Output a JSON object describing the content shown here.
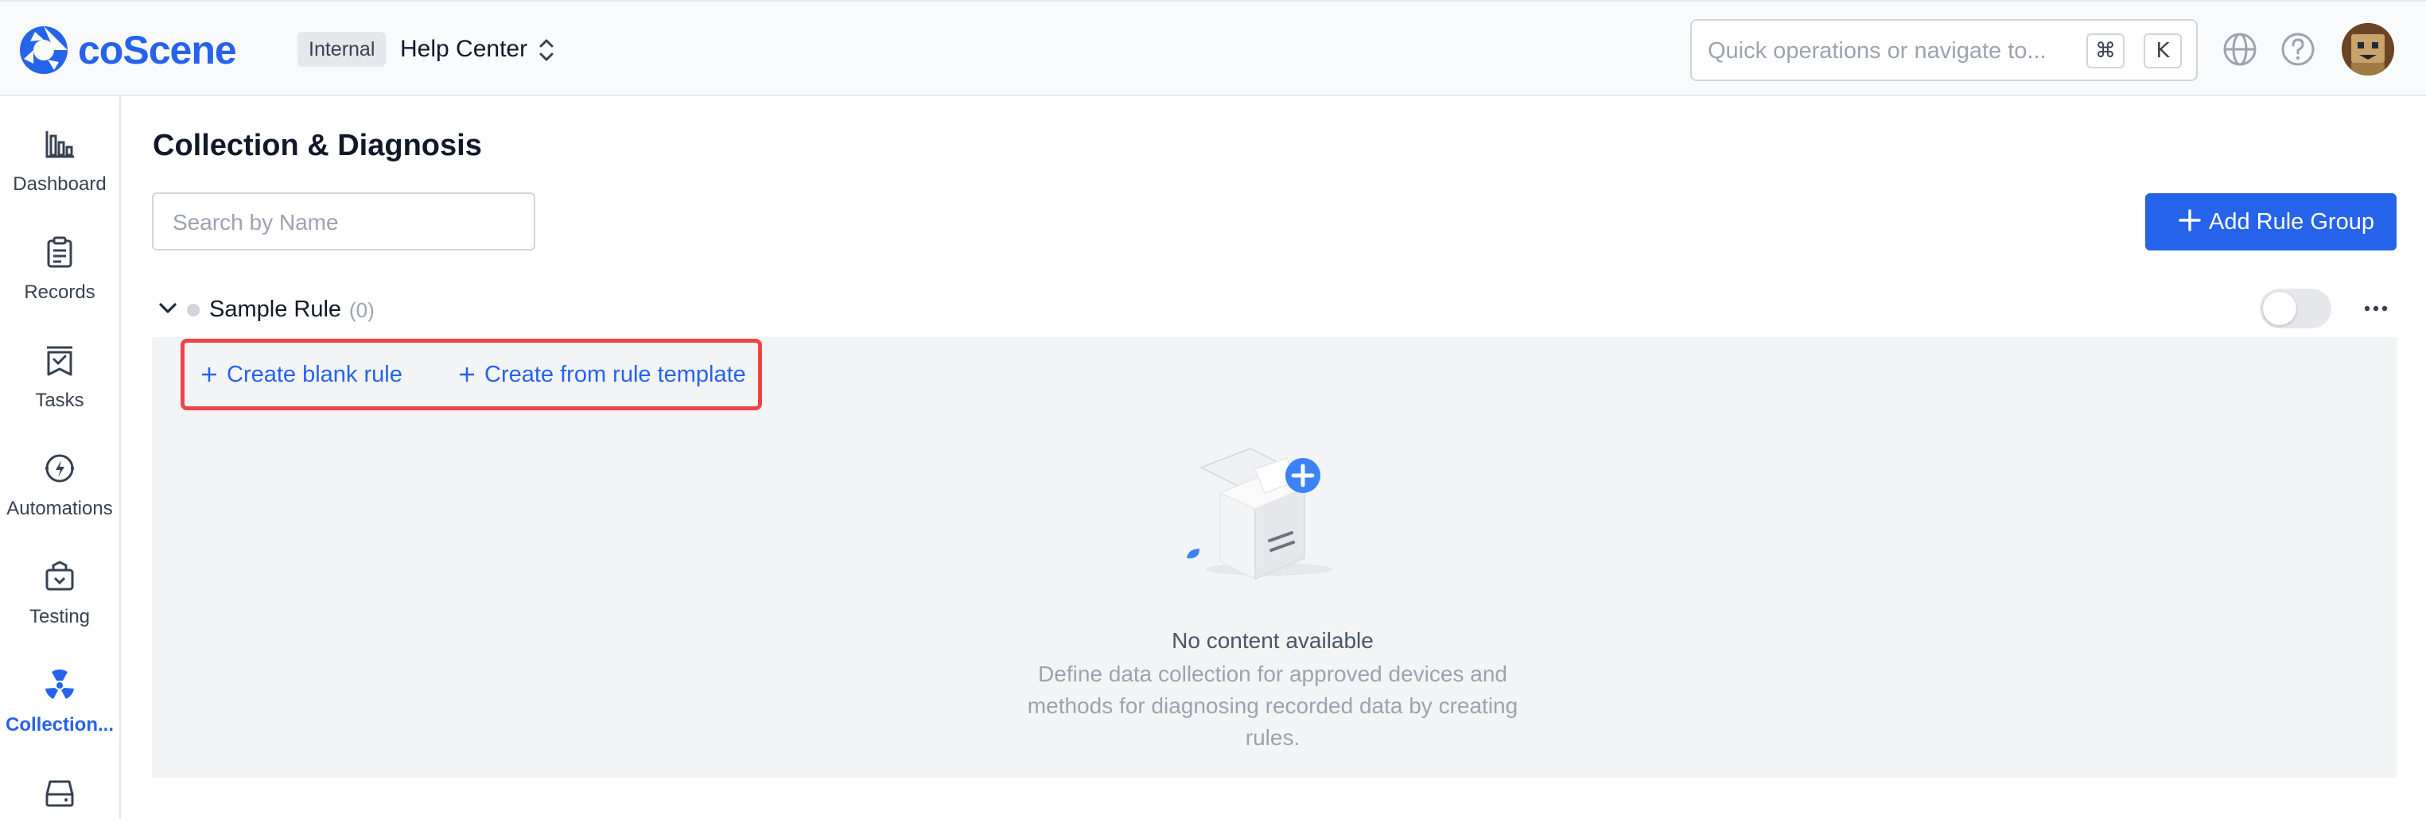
{
  "header": {
    "logo_text": "coScene",
    "org_badge": "Internal",
    "org_name": "Help Center",
    "search_placeholder": "Quick operations or navigate to...",
    "shortcut_keys": [
      "⌘",
      "K"
    ],
    "icons": [
      "globe-icon",
      "help-icon"
    ]
  },
  "sidebar": {
    "items": [
      {
        "label": "Dashboard",
        "icon": "dashboard-icon",
        "active": false
      },
      {
        "label": "Records",
        "icon": "records-icon",
        "active": false
      },
      {
        "label": "Tasks",
        "icon": "tasks-icon",
        "active": false
      },
      {
        "label": "Automations",
        "icon": "automations-icon",
        "active": false
      },
      {
        "label": "Testing",
        "icon": "testing-icon",
        "active": false
      },
      {
        "label": "Collection...",
        "icon": "collection-icon",
        "active": true
      }
    ]
  },
  "main": {
    "title": "Collection & Diagnosis",
    "search_placeholder": "Search by Name",
    "add_button": "Add Rule Group",
    "group": {
      "name": "Sample Rule",
      "count": "(0)",
      "enabled": false
    },
    "actions": {
      "create_blank": "Create blank rule",
      "create_template": "Create from rule template"
    },
    "empty": {
      "title": "No content available",
      "description": "Define data collection for approved devices and methods for diagnosing recorded data by creating rules."
    }
  },
  "colors": {
    "accent": "#2563eb",
    "highlight": "#ef4444",
    "panel_bg": "#f3f4f6"
  }
}
